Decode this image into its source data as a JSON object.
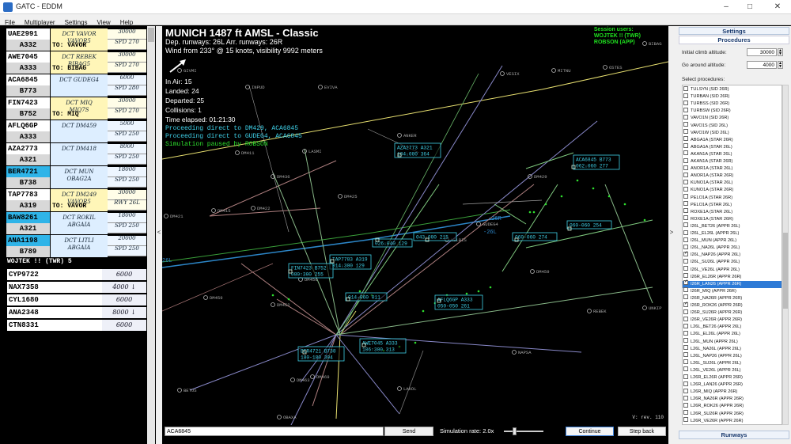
{
  "window": {
    "title": "GATC - EDDM"
  },
  "menu": [
    "File",
    "Multiplayer",
    "Settings",
    "View",
    "Help"
  ],
  "strips": [
    {
      "callsign": "UAE2991",
      "type": "A332",
      "route": "DCT VAVOR\nVAVOR5",
      "dest": "TO: VAVOR",
      "alt1": "30000",
      "alt2": "SPD 270",
      "color": "yellow",
      "highlight": false
    },
    {
      "callsign": "AWE7045",
      "type": "A333",
      "route": "DCT REBEK\nBIBAG5",
      "dest": "TO: BIBAG",
      "alt1": "30000",
      "alt2": "SPD 270",
      "color": "yellow",
      "highlight": false
    },
    {
      "callsign": "ACA6845",
      "type": "B773",
      "route": "DCT GUDEG4",
      "dest": "",
      "alt1": "6000",
      "alt2": "SPD 280",
      "color": "blue",
      "highlight": false
    },
    {
      "callsign": "FIN7423",
      "type": "B752",
      "route": "DCT MIQ\nMIQ7S",
      "dest": "TO: MIQ",
      "alt1": "30000",
      "alt2": "SPD 270",
      "color": "yellow",
      "highlight": false
    },
    {
      "callsign": "AFLQ6GP",
      "type": "A333",
      "route": "DCT DM459",
      "dest": "",
      "alt1": "5000",
      "alt2": "SPD 250",
      "color": "blue",
      "highlight": false
    },
    {
      "callsign": "AZA2773",
      "type": "A321",
      "route": "DCT DM418",
      "dest": "",
      "alt1": "8000",
      "alt2": "SPD 250",
      "color": "blue",
      "highlight": false
    },
    {
      "callsign": "BER4721",
      "type": "B738",
      "route": "DCT MUN\nOBAG2A",
      "dest": "",
      "alt1": "18000",
      "alt2": "SPD 250",
      "color": "blue",
      "highlight": true
    },
    {
      "callsign": "TAP7783",
      "type": "A319",
      "route": "DCT DM249\nVAVOR5",
      "dest": "TO: VAVOR",
      "alt1": "30000",
      "alt2": "RWY 26L",
      "color": "yellow",
      "highlight": false
    },
    {
      "callsign": "BAW8261",
      "type": "A321",
      "route": "DCT ROKIL\nABGAIA",
      "dest": "",
      "alt1": "18000",
      "alt2": "SPD 250",
      "color": "blue",
      "highlight": true
    },
    {
      "callsign": "ANA1198",
      "type": "B789",
      "route": "DCT LITLI\nABGAIA",
      "dest": "",
      "alt1": "20000",
      "alt2": "SPD 250",
      "color": "blue",
      "highlight": true
    }
  ],
  "tower_label": "WOJTEK !! (TWR) 5",
  "tower_strips": [
    {
      "callsign": "CYP9722",
      "alt": "6000"
    },
    {
      "callsign": "NAX7358",
      "alt": "4000 ↓"
    },
    {
      "callsign": "CYL1680",
      "alt": "6000"
    },
    {
      "callsign": "ANA2348",
      "alt": "8000 ↓"
    },
    {
      "callsign": "CTN8331",
      "alt": "6000"
    }
  ],
  "radar": {
    "airport_title": "MUNICH    1487 ft AMSL - Classic",
    "runways_line": "Dep. runways: 26L    Arr. runways: 26R",
    "wind_line": "Wind from 233° @ 15 knots, visibility 9992 meters",
    "stats": [
      "In Air: 15",
      "Landed: 24",
      "Departed: 25",
      "Collisions: 1",
      "Time elapsed: 01:21:30"
    ],
    "messages": [
      {
        "text": "Proceeding direct to DM429, ACA6845",
        "color": "#3fd0e8"
      },
      {
        "text": "Proceeding direct to GUDEG4, ACA6845",
        "color": "#3fd0e8"
      },
      {
        "text": "Simulation paused by ROBSON",
        "color": "#2ee02e"
      }
    ],
    "session_lines": [
      "Session users:",
      "WOJTEK !! (TWR)",
      "ROBSON (APP)"
    ],
    "version": "V: rev. 110",
    "waypoints": [
      "GIVMI",
      "INPUD",
      "EVIVA",
      "VESIX",
      "MITNU",
      "OSTES",
      "ANKER",
      "LASMI",
      "DM411",
      "DM436",
      "DM425",
      "DM429",
      "DM421",
      "DM415",
      "DM422",
      "BIBAG",
      "DM459",
      "DM450",
      "DM452",
      "DM459",
      "DM463",
      "DM469",
      "REBEK",
      "NAPSA",
      "LAKOL",
      "OBAXA",
      "BETOS",
      "GUDEG4",
      "NELBIS",
      "UNKIP"
    ],
    "runway_labels": [
      "-26R",
      "-26L",
      "26L"
    ],
    "aircraft_labels": [
      {
        "l1": "AZA2773   A321",
        "l2": "104↓080   364"
      },
      {
        "l1": "ACA6845   B773",
        "l2": "062↓060   277"
      },
      {
        "l1": "",
        "l2": "043↓080 215"
      },
      {
        "l1": "",
        "l2": "026↓040 129"
      },
      {
        "l1": "",
        "l2": "060-060 274"
      },
      {
        "l1": "",
        "l2": "060-060 254"
      },
      {
        "l1": "TAP7783   A319",
        "l2": "014↓300   129"
      },
      {
        "l1": "FIN7423   B752",
        "l2": "080↑300   255"
      },
      {
        "l1": "",
        "l2": "014-060 011"
      },
      {
        "l1": "AFLQ6GP   A333",
        "l2": "050-050   261"
      },
      {
        "l1": "AWE7045   A333",
        "l2": "106↑300   313"
      },
      {
        "l1": "BER4721   B738",
        "l2": "180-180   394"
      }
    ]
  },
  "bottom": {
    "command_value": "ACA6845",
    "send_label": "Send",
    "sim_rate": "Simulation rate: 2.0x",
    "sim_rate_value": 2.0,
    "continue_label": "Continue",
    "stepback_label": "Step back"
  },
  "settings": {
    "header": "Settings",
    "procedures_header": "Procedures",
    "initial_climb_label": "Initial climb altitude:",
    "initial_climb_value": "30000",
    "go_around_label": "Go around altitude:",
    "go_around_value": "4000",
    "select_label": "Select procedures:",
    "runways_header": "Runways",
    "procedures": [
      {
        "name": "TULSYN (SID 26R)",
        "checked": false,
        "selected": false
      },
      {
        "name": "TURBAN (SID 26R)",
        "checked": false,
        "selected": false
      },
      {
        "name": "TURBSS (SID 26R)",
        "checked": false,
        "selected": false
      },
      {
        "name": "TURBSW (SID 26R)",
        "checked": false,
        "selected": false
      },
      {
        "name": "VAVO1N (SID 26R)",
        "checked": false,
        "selected": false
      },
      {
        "name": "VAVO1S (SID 26L)",
        "checked": false,
        "selected": false
      },
      {
        "name": "VAVO1W (SID 26L)",
        "checked": false,
        "selected": false
      },
      {
        "name": "ABGA1A (STAR 26R)",
        "checked": false,
        "selected": false
      },
      {
        "name": "ABGA1A (STAR 26L)",
        "checked": false,
        "selected": false
      },
      {
        "name": "AKAN1A (STAR 26L)",
        "checked": false,
        "selected": false
      },
      {
        "name": "AKAN1A (STAR 26R)",
        "checked": false,
        "selected": false
      },
      {
        "name": "ANOR1A (STAR 26L)",
        "checked": false,
        "selected": false
      },
      {
        "name": "ANOR1A (STAR 26R)",
        "checked": false,
        "selected": false
      },
      {
        "name": "KUNO1A (STAR 26L)",
        "checked": false,
        "selected": false
      },
      {
        "name": "KUNO1A (STAR 26R)",
        "checked": false,
        "selected": false
      },
      {
        "name": "PELO1A (STAR 26R)",
        "checked": false,
        "selected": false
      },
      {
        "name": "PELO1A (STAR 26L)",
        "checked": false,
        "selected": false
      },
      {
        "name": "ROXE1A (STAR 26L)",
        "checked": false,
        "selected": false
      },
      {
        "name": "ROXE1A (STAR 26R)",
        "checked": false,
        "selected": false
      },
      {
        "name": "I26L_BET26 (APPR 26L)",
        "checked": false,
        "selected": false
      },
      {
        "name": "I26L_EL26L (APPR 26L)",
        "checked": false,
        "selected": false
      },
      {
        "name": "I26L_MUN (APPR 26L)",
        "checked": false,
        "selected": false
      },
      {
        "name": "I26L_NA26L (APPR 26L)",
        "checked": false,
        "selected": false
      },
      {
        "name": "I26L_NAP26 (APPR 26L)",
        "checked": true,
        "selected": false
      },
      {
        "name": "I26L_SU26L (APPR 26L)",
        "checked": false,
        "selected": false
      },
      {
        "name": "I26L_VE26L (APPR 26L)",
        "checked": false,
        "selected": false
      },
      {
        "name": "I26R_EL26R (APPR 26R)",
        "checked": false,
        "selected": false
      },
      {
        "name": "I26R_LAN26 (APPR 26R)",
        "checked": true,
        "selected": true
      },
      {
        "name": "I26R_MIQ (APPR 26R)",
        "checked": false,
        "selected": false
      },
      {
        "name": "I26R_NA26R (APPR 26R)",
        "checked": false,
        "selected": false
      },
      {
        "name": "I26R_ROK26 (APPR 26R)",
        "checked": true,
        "selected": false
      },
      {
        "name": "I26R_SU26R (APPR 26R)",
        "checked": false,
        "selected": false
      },
      {
        "name": "I26R_VE26R (APPR 26R)",
        "checked": false,
        "selected": false
      },
      {
        "name": "L26L_BET26 (APPR 26L)",
        "checked": false,
        "selected": false
      },
      {
        "name": "L26L_EL26L (APPR 26L)",
        "checked": false,
        "selected": false
      },
      {
        "name": "L26L_MUN (APPR 26L)",
        "checked": false,
        "selected": false
      },
      {
        "name": "L26L_NA26L (APPR 26L)",
        "checked": false,
        "selected": false
      },
      {
        "name": "L26L_NAP26 (APPR 26L)",
        "checked": false,
        "selected": false
      },
      {
        "name": "L26L_SU26L (APPR 26L)",
        "checked": false,
        "selected": false
      },
      {
        "name": "L26L_VE26L (APPR 26L)",
        "checked": false,
        "selected": false
      },
      {
        "name": "L26R_EL26R (APPR 26R)",
        "checked": false,
        "selected": false
      },
      {
        "name": "L26R_LAN26 (APPR 26R)",
        "checked": false,
        "selected": false
      },
      {
        "name": "L26R_MIQ (APPR 26R)",
        "checked": false,
        "selected": false
      },
      {
        "name": "L26R_NA26R (APPR 26R)",
        "checked": false,
        "selected": false
      },
      {
        "name": "L26R_ROK26 (APPR 26R)",
        "checked": false,
        "selected": false
      },
      {
        "name": "L26R_SU26R (APPR 26R)",
        "checked": false,
        "selected": false
      },
      {
        "name": "L26R_VE26R (APPR 26R)",
        "checked": false,
        "selected": false
      }
    ]
  }
}
